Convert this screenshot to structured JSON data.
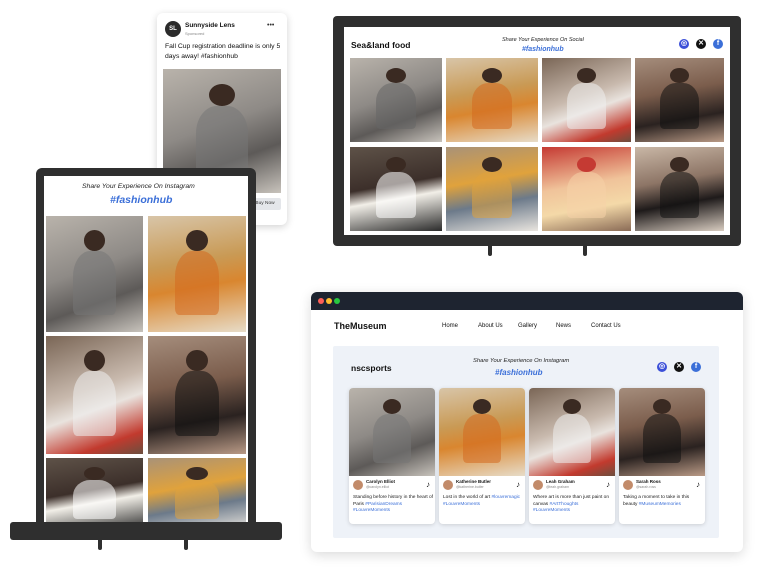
{
  "phone": {
    "avatar_initials": "SL",
    "account": "Sunnyside Lens",
    "sponsored": "Sponsored",
    "more": "•••",
    "caption": "Fall Cup registration deadline is only 5 days away! #fashionhub",
    "cta": "Buy Now"
  },
  "tv": {
    "brand": "Sea&land food",
    "tagline": "Share Your Experience On Social",
    "hashtag": "#fashionhub"
  },
  "tablet": {
    "tagline": "Share Your Experience On Instagram",
    "hashtag": "#fashionhub"
  },
  "browser": {
    "logo": "TheMuseum",
    "nav": [
      "Home",
      "About Us",
      "Gallery",
      "News",
      "Contact Us"
    ],
    "widget_brand": "nscsports",
    "tagline": "Share Your Experience On Instagram",
    "hashtag": "#fashionhub",
    "cards": [
      {
        "name": "Carolyn Elliot",
        "handle": "@carolyn.elliot",
        "text": "Standing before history in the heart of Paris",
        "tags": "#ParisianDreams #LouvreMoments"
      },
      {
        "name": "Katherine Butler",
        "handle": "@katherine.butler",
        "text": "Lost in the world of art",
        "tags": "#louvremagic #LouvreMoments"
      },
      {
        "name": "Leah Graham",
        "handle": "@leah.graham",
        "text": "Where art is more than just paint on canvas",
        "tags": "#ArtThoughts #LouvreMoments"
      },
      {
        "name": "Sarah Ross",
        "handle": "@sarah.ross",
        "text": "Taking a moment to take in this beauty",
        "tags": "#MuseumMemories"
      }
    ]
  },
  "icons": {
    "instagram": "instagram-icon",
    "x": "x-icon",
    "facebook": "facebook-icon",
    "tiktok": "tiktok-icon"
  },
  "colors": {
    "accent": "#3b6fd8",
    "device": "#2f2f2f",
    "browser_bar": "#1e2430",
    "widget_bg": "#eef2f8"
  }
}
